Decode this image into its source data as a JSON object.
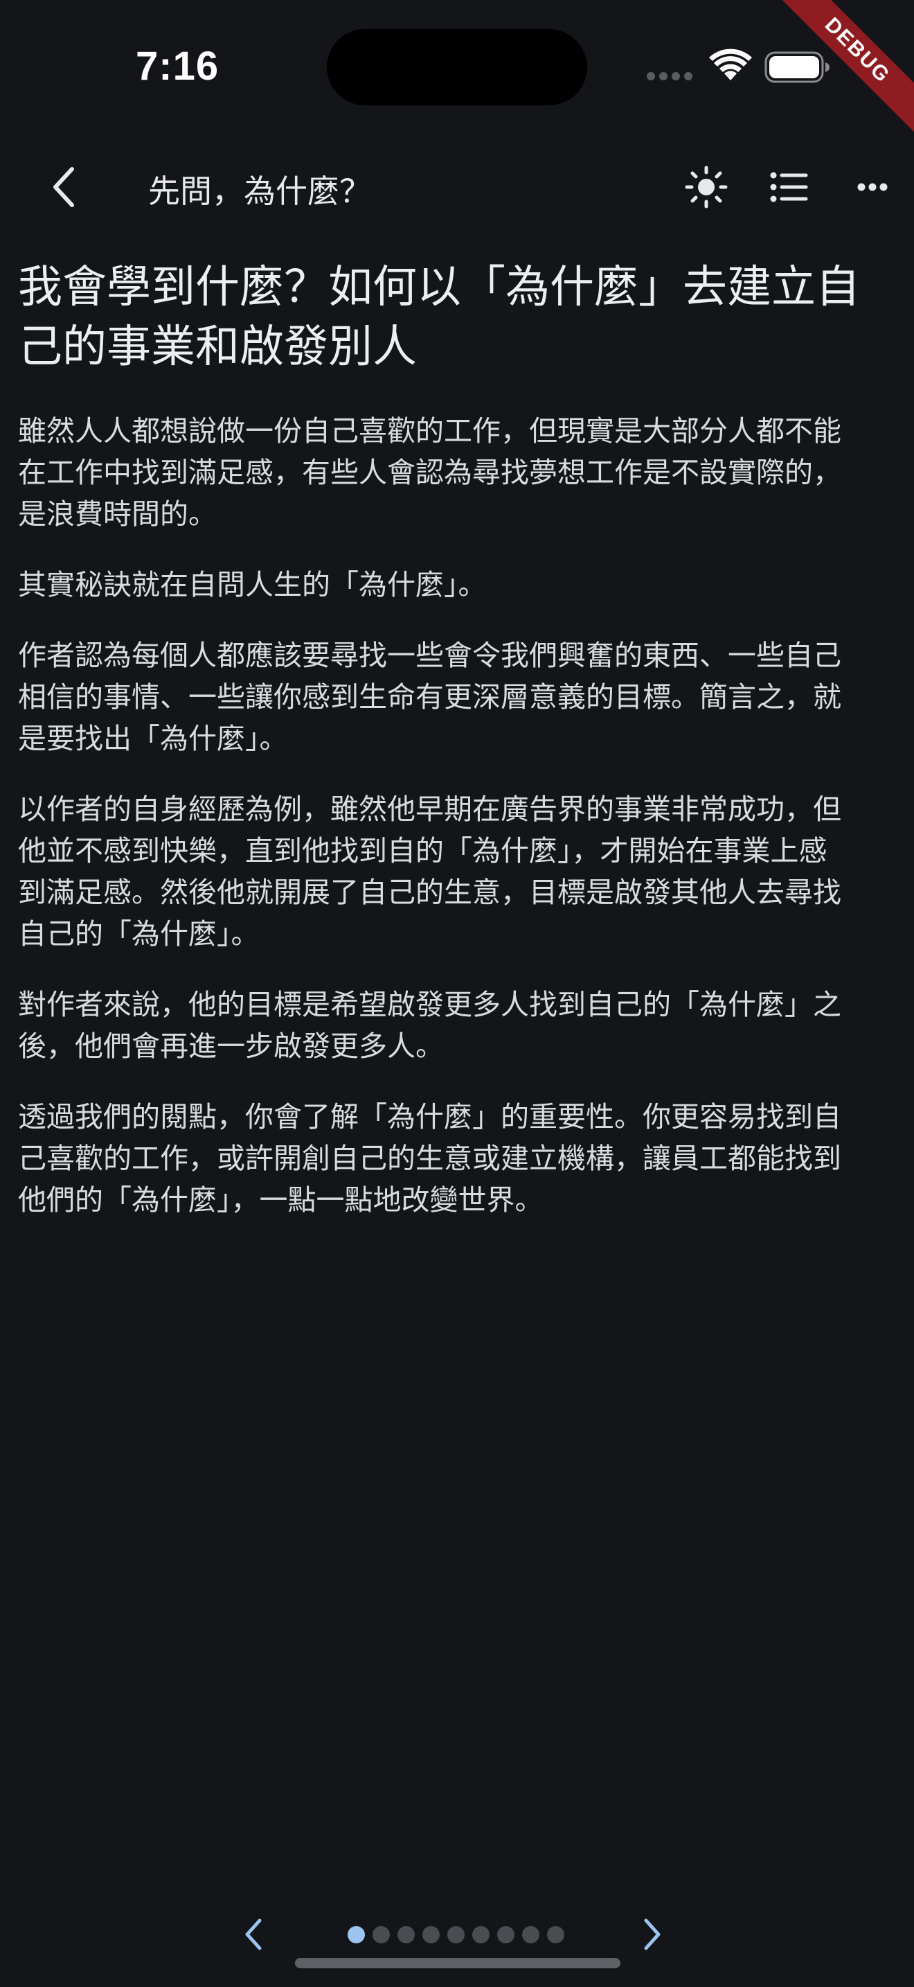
{
  "status_bar": {
    "time": "7:16",
    "debug_label": "DEBUG"
  },
  "app_bar": {
    "title": "先問，為什麼？",
    "back_icon": "chevron-left-icon",
    "actions": [
      "brightness-icon",
      "list-icon",
      "more-horizontal-icon"
    ]
  },
  "article": {
    "heading_lines": [
      "我會學到什麼？如何以「為什麼」去建立自",
      "己的事業和啟發別人"
    ],
    "paragraphs": [
      {
        "lines": [
          "雖然人人都想說做一份自己喜歡的工作，但現實是大部分人都不能",
          "在工作中找到滿足感，有些人會認為尋找夢想工作是不設實際的，",
          "是浪費時間的。"
        ]
      },
      {
        "lines": [
          "其實秘訣就在自問人生的「為什麼」。"
        ]
      },
      {
        "lines": [
          "作者認為每個人都應該要尋找一些會令我們興奮的東西、一些自己",
          "相信的事情、一些讓你感到生命有更深層意義的目標。簡言之，就",
          "是要找出「為什麼」。"
        ]
      },
      {
        "lines": [
          "以作者的自身經歷為例，雖然他早期在廣告界的事業非常成功，但",
          "他並不感到快樂，直到他找到自的「為什麼」，才開始在事業上感",
          "到滿足感。然後他就開展了自己的生意，目標是啟發其他人去尋找",
          "自己的「為什麼」。"
        ]
      },
      {
        "lines": [
          "對作者來說，他的目標是希望啟發更多人找到自己的「為什麼」之",
          "後，他們會再進一步啟發更多人。"
        ]
      },
      {
        "lines": [
          "透過我們的閱點，你會了解「為什麼」的重要性。你更容易找到自",
          "己喜歡的工作，或許開創自己的生意或建立機構，讓員工都能找到",
          "他們的「為什麼」，一點一點地改變世界。"
        ]
      }
    ]
  },
  "pager": {
    "prev_icon": "chevron-left-icon",
    "next_icon": "chevron-right-icon",
    "page_count": 9,
    "current_page": 1
  },
  "colors": {
    "background": "#131519",
    "text": "#d9dbdf",
    "accent": "#9cc4ee",
    "debug_ribbon": "#8e1c20"
  }
}
